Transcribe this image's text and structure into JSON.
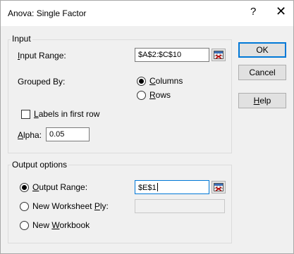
{
  "window": {
    "title": "Anova: Single Factor",
    "help_glyph": "?",
    "close_glyph": "✕"
  },
  "input_group": {
    "title": "Input",
    "input_range_label_pre": "",
    "input_range_label_u": "I",
    "input_range_label_post": "nput Range:",
    "input_range_value": "$A$2:$C$10",
    "grouped_by_label": "Grouped By:",
    "columns_label_u": "C",
    "columns_label_post": "olumns",
    "columns_checked": true,
    "rows_label_u": "R",
    "rows_label_post": "ows",
    "rows_checked": false,
    "labels_checkbox_u": "L",
    "labels_checkbox_post": "abels in first row",
    "labels_checked": false,
    "alpha_label_u": "A",
    "alpha_label_post": "lpha:",
    "alpha_value": "0.05"
  },
  "output_group": {
    "title": "Output options",
    "output_range_u": "O",
    "output_range_post": "utput Range:",
    "output_range_checked": true,
    "output_range_value": "$E$1",
    "new_ws_pre": "New Worksheet ",
    "new_ws_u": "P",
    "new_ws_post": "ly:",
    "new_ws_checked": false,
    "new_ws_value": "",
    "new_wb_pre": "New ",
    "new_wb_u": "W",
    "new_wb_post": "orkbook",
    "new_wb_checked": false
  },
  "buttons": {
    "ok": "OK",
    "cancel": "Cancel",
    "help_u": "H",
    "help_post": "elp"
  },
  "icons": {
    "range_selector": "range-selector-icon"
  },
  "colors": {
    "accent": "#0078d7",
    "window_bg": "#f0f0f0",
    "titlebar_bg": "#ffffff"
  }
}
